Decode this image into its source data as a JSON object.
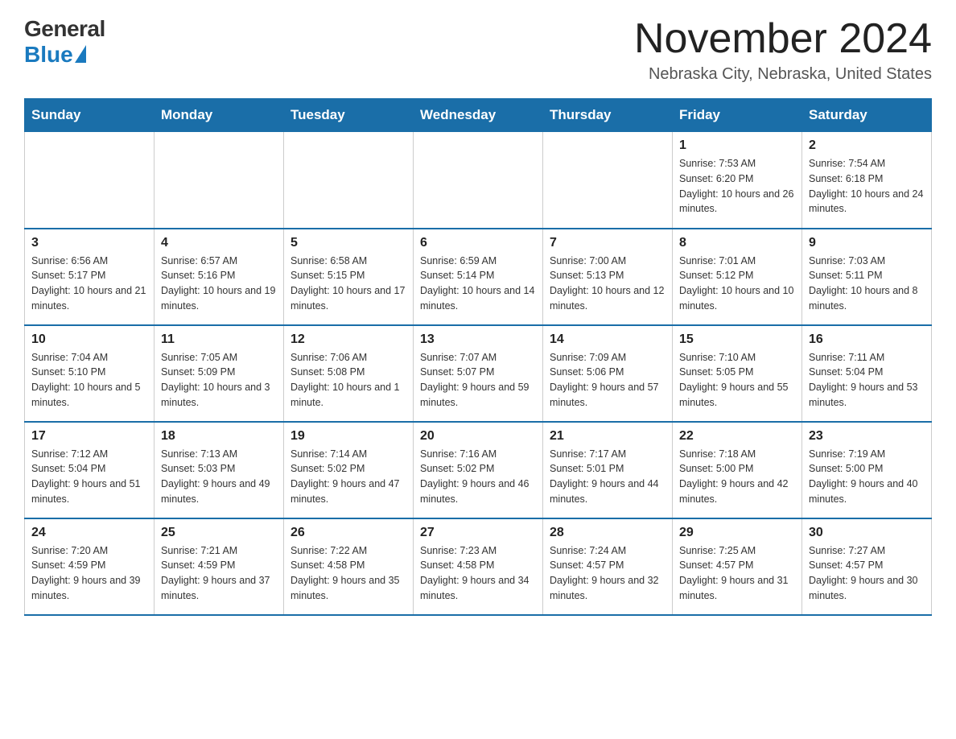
{
  "logo": {
    "general": "General",
    "blue": "Blue"
  },
  "header": {
    "title": "November 2024",
    "subtitle": "Nebraska City, Nebraska, United States"
  },
  "days_of_week": [
    "Sunday",
    "Monday",
    "Tuesday",
    "Wednesday",
    "Thursday",
    "Friday",
    "Saturday"
  ],
  "weeks": [
    [
      {
        "day": "",
        "info": ""
      },
      {
        "day": "",
        "info": ""
      },
      {
        "day": "",
        "info": ""
      },
      {
        "day": "",
        "info": ""
      },
      {
        "day": "",
        "info": ""
      },
      {
        "day": "1",
        "info": "Sunrise: 7:53 AM\nSunset: 6:20 PM\nDaylight: 10 hours and 26 minutes."
      },
      {
        "day": "2",
        "info": "Sunrise: 7:54 AM\nSunset: 6:18 PM\nDaylight: 10 hours and 24 minutes."
      }
    ],
    [
      {
        "day": "3",
        "info": "Sunrise: 6:56 AM\nSunset: 5:17 PM\nDaylight: 10 hours and 21 minutes."
      },
      {
        "day": "4",
        "info": "Sunrise: 6:57 AM\nSunset: 5:16 PM\nDaylight: 10 hours and 19 minutes."
      },
      {
        "day": "5",
        "info": "Sunrise: 6:58 AM\nSunset: 5:15 PM\nDaylight: 10 hours and 17 minutes."
      },
      {
        "day": "6",
        "info": "Sunrise: 6:59 AM\nSunset: 5:14 PM\nDaylight: 10 hours and 14 minutes."
      },
      {
        "day": "7",
        "info": "Sunrise: 7:00 AM\nSunset: 5:13 PM\nDaylight: 10 hours and 12 minutes."
      },
      {
        "day": "8",
        "info": "Sunrise: 7:01 AM\nSunset: 5:12 PM\nDaylight: 10 hours and 10 minutes."
      },
      {
        "day": "9",
        "info": "Sunrise: 7:03 AM\nSunset: 5:11 PM\nDaylight: 10 hours and 8 minutes."
      }
    ],
    [
      {
        "day": "10",
        "info": "Sunrise: 7:04 AM\nSunset: 5:10 PM\nDaylight: 10 hours and 5 minutes."
      },
      {
        "day": "11",
        "info": "Sunrise: 7:05 AM\nSunset: 5:09 PM\nDaylight: 10 hours and 3 minutes."
      },
      {
        "day": "12",
        "info": "Sunrise: 7:06 AM\nSunset: 5:08 PM\nDaylight: 10 hours and 1 minute."
      },
      {
        "day": "13",
        "info": "Sunrise: 7:07 AM\nSunset: 5:07 PM\nDaylight: 9 hours and 59 minutes."
      },
      {
        "day": "14",
        "info": "Sunrise: 7:09 AM\nSunset: 5:06 PM\nDaylight: 9 hours and 57 minutes."
      },
      {
        "day": "15",
        "info": "Sunrise: 7:10 AM\nSunset: 5:05 PM\nDaylight: 9 hours and 55 minutes."
      },
      {
        "day": "16",
        "info": "Sunrise: 7:11 AM\nSunset: 5:04 PM\nDaylight: 9 hours and 53 minutes."
      }
    ],
    [
      {
        "day": "17",
        "info": "Sunrise: 7:12 AM\nSunset: 5:04 PM\nDaylight: 9 hours and 51 minutes."
      },
      {
        "day": "18",
        "info": "Sunrise: 7:13 AM\nSunset: 5:03 PM\nDaylight: 9 hours and 49 minutes."
      },
      {
        "day": "19",
        "info": "Sunrise: 7:14 AM\nSunset: 5:02 PM\nDaylight: 9 hours and 47 minutes."
      },
      {
        "day": "20",
        "info": "Sunrise: 7:16 AM\nSunset: 5:02 PM\nDaylight: 9 hours and 46 minutes."
      },
      {
        "day": "21",
        "info": "Sunrise: 7:17 AM\nSunset: 5:01 PM\nDaylight: 9 hours and 44 minutes."
      },
      {
        "day": "22",
        "info": "Sunrise: 7:18 AM\nSunset: 5:00 PM\nDaylight: 9 hours and 42 minutes."
      },
      {
        "day": "23",
        "info": "Sunrise: 7:19 AM\nSunset: 5:00 PM\nDaylight: 9 hours and 40 minutes."
      }
    ],
    [
      {
        "day": "24",
        "info": "Sunrise: 7:20 AM\nSunset: 4:59 PM\nDaylight: 9 hours and 39 minutes."
      },
      {
        "day": "25",
        "info": "Sunrise: 7:21 AM\nSunset: 4:59 PM\nDaylight: 9 hours and 37 minutes."
      },
      {
        "day": "26",
        "info": "Sunrise: 7:22 AM\nSunset: 4:58 PM\nDaylight: 9 hours and 35 minutes."
      },
      {
        "day": "27",
        "info": "Sunrise: 7:23 AM\nSunset: 4:58 PM\nDaylight: 9 hours and 34 minutes."
      },
      {
        "day": "28",
        "info": "Sunrise: 7:24 AM\nSunset: 4:57 PM\nDaylight: 9 hours and 32 minutes."
      },
      {
        "day": "29",
        "info": "Sunrise: 7:25 AM\nSunset: 4:57 PM\nDaylight: 9 hours and 31 minutes."
      },
      {
        "day": "30",
        "info": "Sunrise: 7:27 AM\nSunset: 4:57 PM\nDaylight: 9 hours and 30 minutes."
      }
    ]
  ]
}
